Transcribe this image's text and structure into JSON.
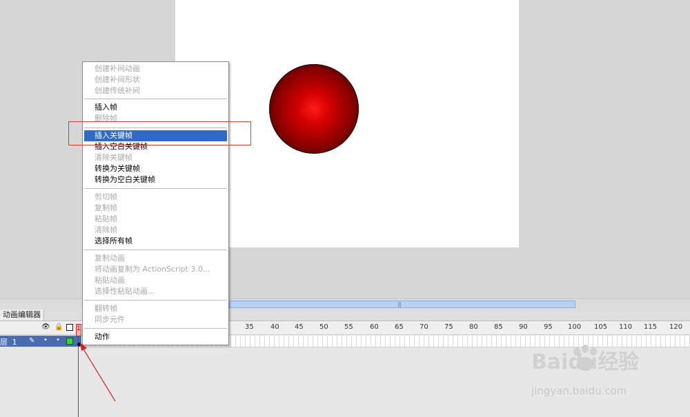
{
  "stage": {
    "background": "#ffffff",
    "ball_color": "#ff0000"
  },
  "timeline": {
    "tab_label": "动画编辑器",
    "layer_name": "层 1",
    "playhead_frame": "1",
    "ruler": [
      "35",
      "40",
      "45",
      "50",
      "55",
      "60",
      "65",
      "70",
      "75",
      "80",
      "85",
      "90",
      "95",
      "100",
      "105",
      "110",
      "115",
      "120"
    ],
    "icons": [
      "eye-icon",
      "lock-icon",
      "outline-square-icon",
      "pencil-icon"
    ]
  },
  "context_menu": {
    "items": [
      {
        "label": "创建补间动画",
        "enabled": false
      },
      {
        "label": "创建补间形状",
        "enabled": false
      },
      {
        "label": "创建传统补间",
        "enabled": false
      },
      {
        "label": "插入帧",
        "enabled": true
      },
      {
        "label": "删除帧",
        "enabled": false
      },
      {
        "label": "插入关键帧",
        "enabled": true,
        "selected": true
      },
      {
        "label": "插入空白关键帧",
        "enabled": true
      },
      {
        "label": "清除关键帧",
        "enabled": false
      },
      {
        "label": "转换为关键帧",
        "enabled": true
      },
      {
        "label": "转换为空白关键帧",
        "enabled": true
      },
      {
        "label": "剪切帧",
        "enabled": false
      },
      {
        "label": "复制帧",
        "enabled": false
      },
      {
        "label": "粘贴帧",
        "enabled": false
      },
      {
        "label": "清除帧",
        "enabled": false
      },
      {
        "label": "选择所有帧",
        "enabled": true
      },
      {
        "label": "复制动画",
        "enabled": false
      },
      {
        "label": "将动画复制为 ActionScript 3.0...",
        "enabled": false
      },
      {
        "label": "粘贴动画",
        "enabled": false
      },
      {
        "label": "选择性粘贴动画...",
        "enabled": false
      },
      {
        "label": "翻转帧",
        "enabled": false
      },
      {
        "label": "同步元件",
        "enabled": false
      },
      {
        "label": "动作",
        "enabled": true
      }
    ],
    "selected_color": "#316ac5"
  },
  "watermark": {
    "brand": "Baidu经验",
    "url": "jingyan.baidu.com"
  },
  "annotation_color": "#e03a3a"
}
